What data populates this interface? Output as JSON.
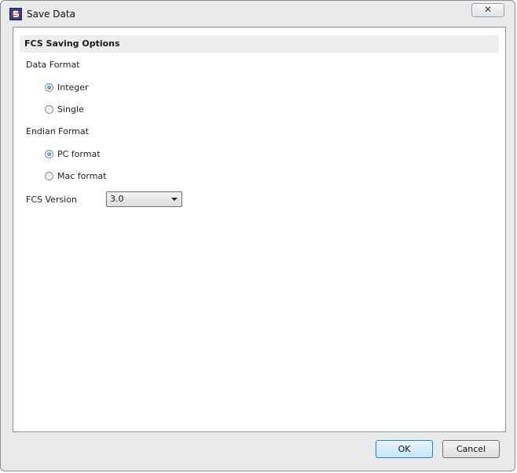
{
  "window": {
    "title": "Save Data",
    "close_symbol": "✕"
  },
  "section": {
    "title": "FCS Saving Options"
  },
  "data_format": {
    "label": "Data Format",
    "options": [
      "Integer",
      "Single"
    ],
    "selected": "Integer"
  },
  "endian_format": {
    "label": "Endian Format",
    "options": [
      "PC format",
      "Mac format"
    ],
    "selected": "PC format"
  },
  "fcs_version": {
    "label": "FCS Version",
    "value": "3.0"
  },
  "buttons": {
    "ok": "OK",
    "cancel": "Cancel"
  },
  "icons": {
    "app": "fcs-express-app-icon",
    "close": "close-icon",
    "dropdown": "chevron-down-icon"
  },
  "colors": {
    "accent": "#3c7fb1",
    "window_bg": "#e9eaec",
    "panel_bg": "#ffffff"
  }
}
